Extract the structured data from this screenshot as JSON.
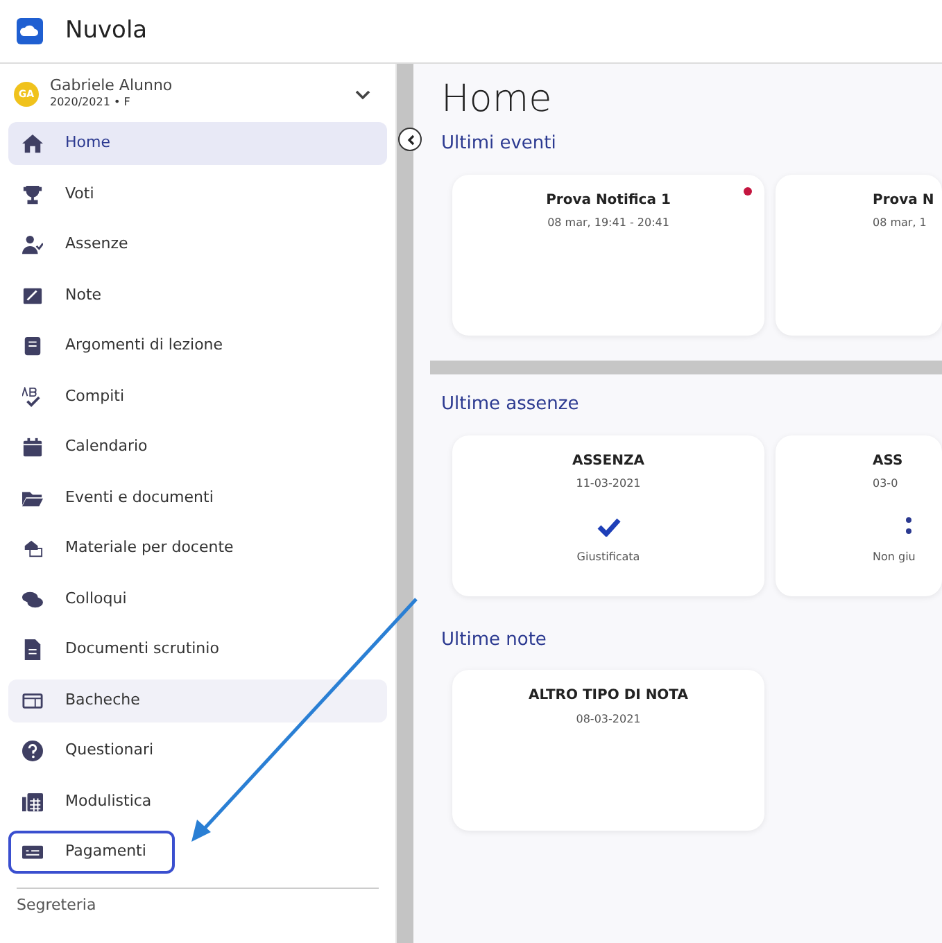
{
  "app": {
    "title": "Nuvola"
  },
  "user": {
    "initials": "GA",
    "name": "Gabriele Alunno",
    "subtitle": "2020/2021 • F"
  },
  "sidebar": {
    "items": [
      {
        "label": "Home",
        "selected": true,
        "hovered": false,
        "highlighted": false
      },
      {
        "label": "Voti",
        "selected": false,
        "hovered": false,
        "highlighted": false
      },
      {
        "label": "Assenze",
        "selected": false,
        "hovered": false,
        "highlighted": false
      },
      {
        "label": "Note",
        "selected": false,
        "hovered": false,
        "highlighted": false
      },
      {
        "label": "Argomenti di lezione",
        "selected": false,
        "hovered": false,
        "highlighted": false
      },
      {
        "label": "Compiti",
        "selected": false,
        "hovered": false,
        "highlighted": false
      },
      {
        "label": "Calendario",
        "selected": false,
        "hovered": false,
        "highlighted": false
      },
      {
        "label": "Eventi e documenti",
        "selected": false,
        "hovered": false,
        "highlighted": false
      },
      {
        "label": "Materiale per docente",
        "selected": false,
        "hovered": false,
        "highlighted": false
      },
      {
        "label": "Colloqui",
        "selected": false,
        "hovered": false,
        "highlighted": false
      },
      {
        "label": "Documenti scrutinio",
        "selected": false,
        "hovered": false,
        "highlighted": false
      },
      {
        "label": "Bacheche",
        "selected": false,
        "hovered": true,
        "highlighted": false
      },
      {
        "label": "Questionari",
        "selected": false,
        "hovered": false,
        "highlighted": false
      },
      {
        "label": "Modulistica",
        "selected": false,
        "hovered": false,
        "highlighted": false
      },
      {
        "label": "Pagamenti",
        "selected": false,
        "hovered": false,
        "highlighted": true
      }
    ],
    "section": "Segreteria"
  },
  "main": {
    "title": "Home",
    "sections": [
      {
        "heading": "Ultimi eventi",
        "scrollbar": true,
        "cards": [
          {
            "title": "Prova Notifica 1",
            "subtitle": "08 mar, 19:41 - 20:41",
            "unread": true,
            "clipped": false
          },
          {
            "title": "Prova N",
            "subtitle": "08 mar, 1",
            "unread": false,
            "clipped": true
          }
        ]
      },
      {
        "heading": "Ultime assenze",
        "scrollbar": false,
        "cards": [
          {
            "title": "ASSENZA",
            "subtitle": "11-03-2021",
            "status": "Giustificata",
            "justified": true,
            "clipped": false
          },
          {
            "title": "ASS",
            "subtitle": "03-0",
            "status": "Non giu",
            "justified": false,
            "clipped": true
          }
        ]
      },
      {
        "heading": "Ultime note",
        "scrollbar": false,
        "cards": [
          {
            "title": "ALTRO TIPO DI NOTA",
            "subtitle": "08-03-2021",
            "clipped": false
          }
        ]
      }
    ]
  }
}
